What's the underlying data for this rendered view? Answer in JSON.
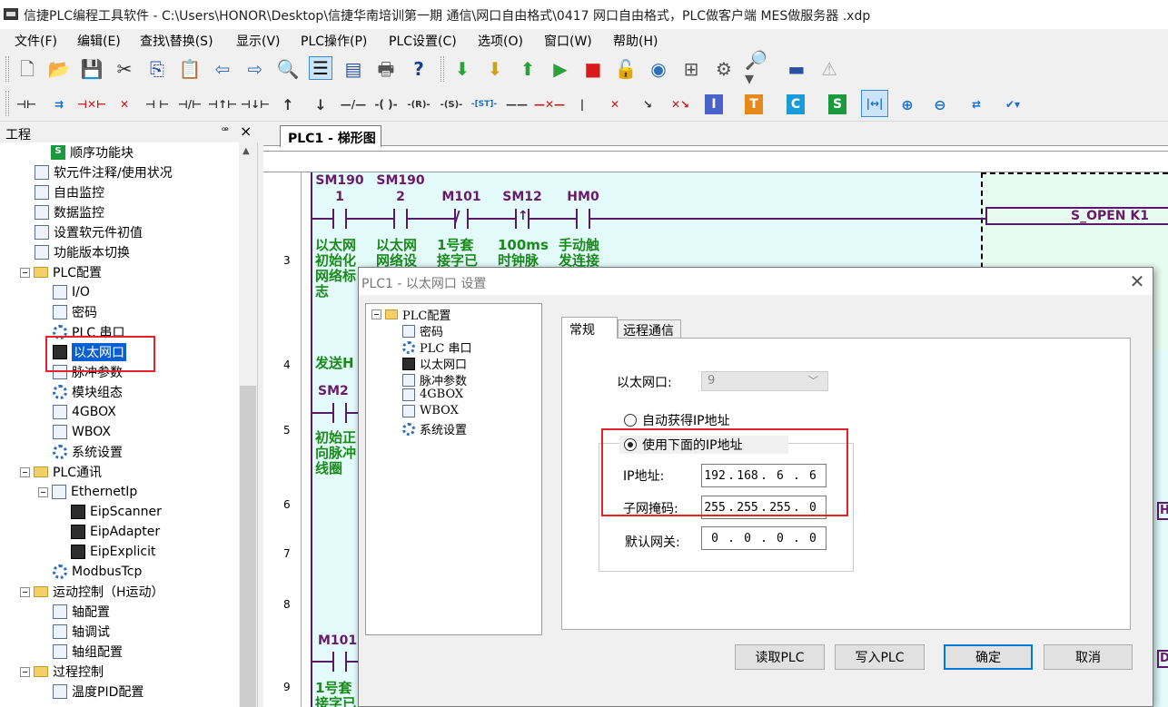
{
  "window": {
    "title": "信捷PLC编程工具软件 - C:\\Users\\HONOR\\Desktop\\信捷华南培训第一期 通信\\网口自由格式\\0417 网口自由格式，PLC做客户端 MES做服务器 .xdp"
  },
  "menu": [
    "文件(F)",
    "编辑(E)",
    "查找\\替换(S)",
    "显示(V)",
    "PLC操作(P)",
    "PLC设置(C)",
    "选项(O)",
    "窗口(W)",
    "帮助(H)"
  ],
  "toolbar2": {
    "letters": [
      "I",
      "T",
      "C",
      "S"
    ],
    "letter_colors": [
      "#4a63c9",
      "#e58a1a",
      "#1a9ad8",
      "#1a9a3c"
    ]
  },
  "project_panel": {
    "title": "工程",
    "pin": "ꟹ",
    "close": "×",
    "items": [
      {
        "label": "顺序功能块",
        "icon": "grn",
        "icon_text": "S"
      },
      {
        "label": "软元件注释/使用状况",
        "icon": "doc"
      },
      {
        "label": "自由监控",
        "icon": "doc"
      },
      {
        "label": "数据监控",
        "icon": "doc"
      },
      {
        "label": "设置软元件初值",
        "icon": "doc"
      },
      {
        "label": "功能版本切换",
        "icon": "doc"
      },
      {
        "label": "PLC配置",
        "icon": "folder"
      },
      {
        "label": "I/O",
        "icon": "doc"
      },
      {
        "label": "密码",
        "icon": "doc"
      },
      {
        "label": "PLC 串口",
        "icon": "gear"
      },
      {
        "label": "以太网口",
        "icon": "eth"
      },
      {
        "label": "脉冲参数",
        "icon": "doc"
      },
      {
        "label": "模块组态",
        "icon": "gear"
      },
      {
        "label": "4GBOX",
        "icon": "doc"
      },
      {
        "label": "WBOX",
        "icon": "doc"
      },
      {
        "label": "系统设置",
        "icon": "gear"
      },
      {
        "label": "PLC通讯",
        "icon": "folder"
      },
      {
        "label": "EthernetIp",
        "icon": "doc"
      },
      {
        "label": "EipScanner",
        "icon": "eth"
      },
      {
        "label": "EipAdapter",
        "icon": "eth"
      },
      {
        "label": "EipExplicit",
        "icon": "eth"
      },
      {
        "label": "ModbusTcp",
        "icon": "gear"
      },
      {
        "label": "运动控制（H运动）",
        "icon": "folder"
      },
      {
        "label": "轴配置",
        "icon": "doc"
      },
      {
        "label": "轴调试",
        "icon": "doc"
      },
      {
        "label": "轴组配置",
        "icon": "doc"
      },
      {
        "label": "过程控制",
        "icon": "folder"
      },
      {
        "label": "温度PID配置",
        "icon": "doc"
      }
    ]
  },
  "editor": {
    "tab": "PLC1 - 梯形图",
    "rungs": [
      "3",
      "4",
      "5",
      "6",
      "7",
      "8",
      "9"
    ],
    "contacts": [
      {
        "name1": "SM190",
        "name2": "1",
        "comment": "以太网初始化网络标志"
      },
      {
        "name1": "SM190",
        "name2": "2",
        "comment": "以太网网络设"
      },
      {
        "name1": "",
        "name2": "M101",
        "comment": "1号套接字已"
      },
      {
        "name1": "",
        "name2": "SM12",
        "comment": "100ms时钟脉"
      },
      {
        "name1": "",
        "name2": "HM0",
        "comment": "手动触发连接"
      }
    ],
    "coil": "S_OPEN    K1",
    "rung4_comment": "发送H",
    "rung5_contact": "SM2",
    "rung5_comment": "初始正向脉冲线圈",
    "rung9_contact": "M101",
    "rung9_comment": "1号套接字已",
    "edge_letters": [
      "H",
      "D"
    ]
  },
  "dialog": {
    "title": "PLC1 - 以太网口  设置",
    "close": "✕",
    "tree": [
      {
        "label": "PLC配置",
        "icon": "folder"
      },
      {
        "label": "密码",
        "icon": "doc"
      },
      {
        "label": "PLC 串口",
        "icon": "gear"
      },
      {
        "label": "以太网口",
        "icon": "eth"
      },
      {
        "label": "脉冲参数",
        "icon": "doc"
      },
      {
        "label": "4GBOX",
        "icon": "doc"
      },
      {
        "label": "WBOX",
        "icon": "doc"
      },
      {
        "label": "系统设置",
        "icon": "gear"
      }
    ],
    "tabs": [
      "常规",
      "远程通信"
    ],
    "eth_port_label": "以太网口:",
    "eth_port_value": "9",
    "radio_auto": "自动获得IP地址",
    "radio_manual": "使用下面的IP地址",
    "ip_label": "IP地址:",
    "ip": [
      "192",
      "168",
      "6",
      "6"
    ],
    "mask_label": "子网掩码:",
    "mask": [
      "255",
      "255",
      "255",
      "0"
    ],
    "gw_label": "默认网关:",
    "gw": [
      "0",
      "0",
      "0",
      "0"
    ],
    "buttons": {
      "read": "读取PLC",
      "write": "写入PLC",
      "ok": "确定",
      "cancel": "取消"
    }
  }
}
